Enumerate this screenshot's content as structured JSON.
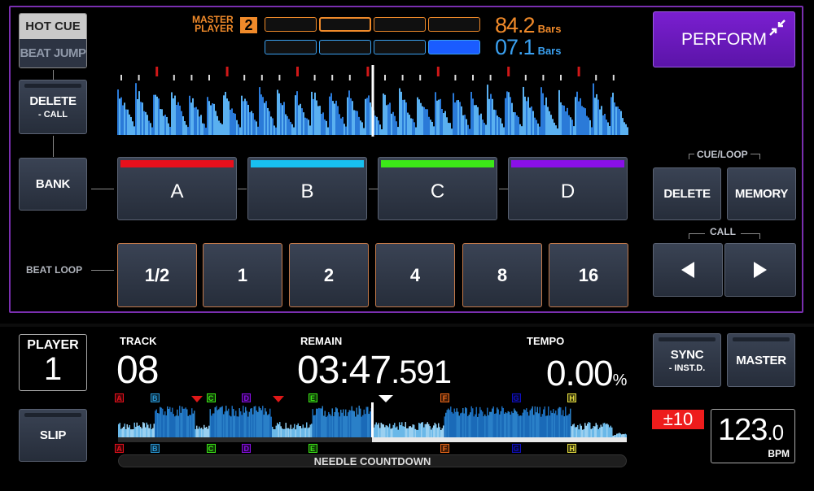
{
  "mode": {
    "hot_cue_label": "HOT CUE",
    "beat_jump_label": "BEAT JUMP",
    "active": "HOT CUE"
  },
  "master": {
    "label_line1": "MASTER",
    "label_line2": "PLAYER",
    "player_number": "2",
    "phase_meter": {
      "master_cells": 4,
      "master_active_index": 1,
      "this_cells": 4,
      "this_active_index": 3
    },
    "master_bars_value": "84.2",
    "this_bars_value": "07.1",
    "bars_unit": "Bars",
    "colors": {
      "master": "#f08a2a",
      "this": "#3aa0f0",
      "active_fill": "#1a5cff"
    }
  },
  "perform_button": {
    "label": "PERFORM",
    "icon": "collapse-arrows-icon"
  },
  "left_controls": {
    "delete_call": {
      "label": "DELETE",
      "sub": "- CALL"
    },
    "bank": {
      "label": "BANK"
    },
    "beat_loop_label": "BEAT LOOP"
  },
  "hot_cue_pads": [
    {
      "label": "A",
      "color": "#e8101c"
    },
    {
      "label": "B",
      "color": "#18c0f0"
    },
    {
      "label": "C",
      "color": "#3ce818"
    },
    {
      "label": "D",
      "color": "#8a10e8"
    }
  ],
  "beat_loop_pads": [
    {
      "label": "1/2"
    },
    {
      "label": "1"
    },
    {
      "label": "2"
    },
    {
      "label": "4"
    },
    {
      "label": "8"
    },
    {
      "label": "16"
    }
  ],
  "cue_loop": {
    "group_label": "CUE/LOOP",
    "delete_label": "DELETE",
    "memory_label": "MEMORY",
    "call_label": "CALL",
    "prev_icon": "triangle-left-icon",
    "next_icon": "triangle-right-icon"
  },
  "deck": {
    "player_label": "PLAYER",
    "player_number": "1",
    "track_label": "TRACK",
    "track_number": "08",
    "remain_label": "REMAIN",
    "remain_main": "03:47",
    "remain_fraction": ".591",
    "tempo_label": "TEMPO",
    "tempo_value": "0.00",
    "tempo_unit": "%",
    "slip_label": "SLIP",
    "sync_label": "SYNC",
    "sync_sub": "- INST.D.",
    "master_label": "MASTER",
    "tempo_range": "±10",
    "bpm_value": "123",
    "bpm_fraction": ".0",
    "bpm_unit": "BPM",
    "needle_label": "NEEDLE COUNTDOWN",
    "playhead_position": 0.5,
    "memory_cue_markers": [
      0.15,
      0.31
    ],
    "hot_cue_markers": [
      {
        "label": "A",
        "pos": 0.0,
        "color": "#e8101c"
      },
      {
        "label": "B",
        "pos": 0.07,
        "color": "#2a9ad8"
      },
      {
        "label": "C",
        "pos": 0.18,
        "color": "#3ce818"
      },
      {
        "label": "D",
        "pos": 0.25,
        "color": "#8a10e8"
      },
      {
        "label": "E",
        "pos": 0.38,
        "color": "#3ce818"
      },
      {
        "label": "F",
        "pos": 0.64,
        "color": "#f06a1a"
      },
      {
        "label": "G",
        "pos": 0.78,
        "color": "#1010c0"
      },
      {
        "label": "H",
        "pos": 0.89,
        "color": "#e8e040"
      }
    ]
  }
}
